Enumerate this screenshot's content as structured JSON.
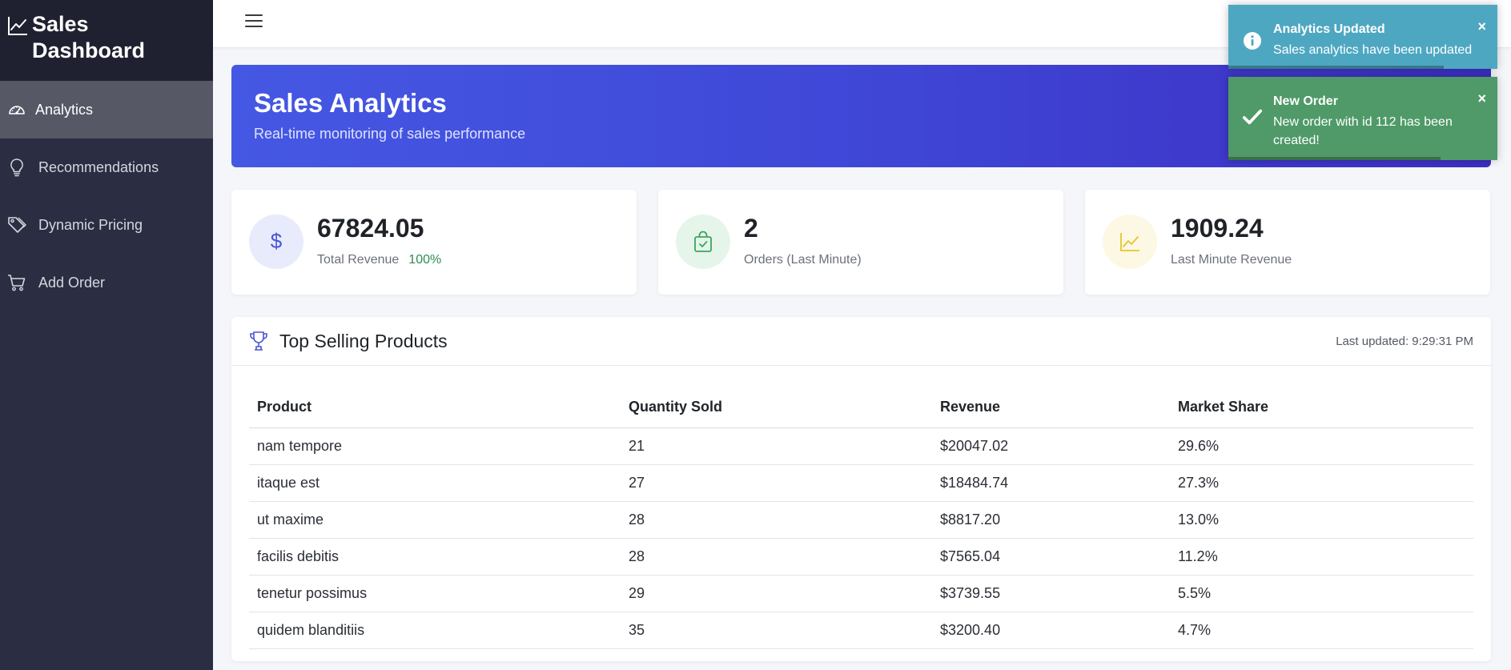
{
  "sidebar": {
    "brand_title": "Sales Dashboard",
    "brand_icon": "line-chart-icon",
    "items": [
      {
        "label": "Analytics",
        "icon": "speedometer-icon",
        "active": true
      },
      {
        "label": "Recommendations",
        "icon": "lightbulb-icon",
        "active": false
      },
      {
        "label": "Dynamic Pricing",
        "icon": "tags-icon",
        "active": false
      },
      {
        "label": "Add Order",
        "icon": "cart-icon",
        "active": false
      }
    ]
  },
  "hero": {
    "title": "Sales Analytics",
    "subtitle": "Real-time monitoring of sales performance"
  },
  "stats": [
    {
      "value": "67824.05",
      "label": "Total Revenue",
      "badge": "100%",
      "icon": "dollar-icon",
      "color": "#4a55d4"
    },
    {
      "value": "2",
      "label": "Orders (Last Minute)",
      "icon": "shopping-bag-icon",
      "color": "#3aa65a"
    },
    {
      "value": "1909.24",
      "label": "Last Minute Revenue",
      "icon": "graph-up-icon",
      "color": "#e7c52f"
    }
  ],
  "products": {
    "title": "Top Selling Products",
    "last_updated": "Last updated: 9:29:31 PM",
    "columns": [
      "Product",
      "Quantity Sold",
      "Revenue",
      "Market Share"
    ],
    "rows": [
      [
        "nam tempore",
        "21",
        "$20047.02",
        "29.6%"
      ],
      [
        "itaque est",
        "27",
        "$18484.74",
        "27.3%"
      ],
      [
        "ut maxime",
        "28",
        "$8817.20",
        "13.0%"
      ],
      [
        "facilis debitis",
        "28",
        "$7565.04",
        "11.2%"
      ],
      [
        "tenetur possimus",
        "29",
        "$3739.55",
        "5.5%"
      ],
      [
        "quidem blanditiis",
        "35",
        "$3200.40",
        "4.7%"
      ]
    ]
  },
  "toasts": [
    {
      "type": "info",
      "title": "Analytics Updated",
      "message": "Sales analytics have been updated",
      "close": "×",
      "progress": 0.8
    },
    {
      "type": "success",
      "title": "New Order",
      "message": "New order with id 112 has been created!",
      "close": "×",
      "progress": 0.79
    }
  ],
  "colors": {
    "sidebar_bg": "#2b2e42",
    "brand_bg": "#1f2130",
    "hero_start": "#4558e3",
    "hero_end": "#3d2fc2",
    "toast_info": "#4ea7c1",
    "toast_success": "#4f9a68"
  }
}
